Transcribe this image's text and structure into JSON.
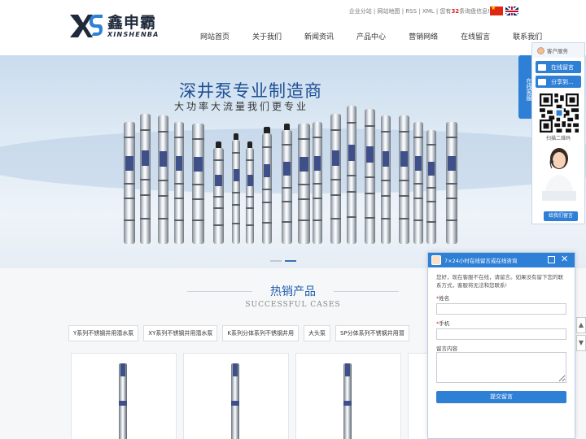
{
  "brand": {
    "name_cn": "鑫申霸",
    "name_en": "XINSHENBA"
  },
  "toplinks": {
    "before": "企业分站 | 网站地图 | RSS | XML | 您有",
    "count": "32",
    "after": "条询盘信息!"
  },
  "nav": {
    "items": [
      {
        "label": "网站首页"
      },
      {
        "label": "关于我们"
      },
      {
        "label": "新闻资讯"
      },
      {
        "label": "产品中心"
      },
      {
        "label": "营销网络"
      },
      {
        "label": "在线留言"
      },
      {
        "label": "联系我们"
      }
    ]
  },
  "banner": {
    "title": "深井泵专业制造商",
    "subtitle": "大功率大流量我们更专业",
    "active_slide": 2
  },
  "hot": {
    "title": "热销产品",
    "subtitle": "SUCCESSFUL CASES",
    "tabs": [
      {
        "label": "Y系列不锈钢井用潜水泵"
      },
      {
        "label": "XY系列不锈钢井用潜水泵"
      },
      {
        "label": "K系列分体系列不锈钢井用"
      },
      {
        "label": "大头泵"
      },
      {
        "label": "SP分体系列不锈钢井用潜"
      }
    ]
  },
  "side": {
    "tab_label": "在线客服",
    "head": "客户服务",
    "btn_message": "在线留言",
    "btn_share": "分享到...",
    "qr_caption": "扫描二维码",
    "leave_msg": "给我们留言"
  },
  "chat": {
    "header": "7×24小时在线留言或在线咨询",
    "welcome": "您好，现在客服不在线，请留言。如果没有留下您的联系方式，客服将无法和您联系!",
    "name_label": "姓名",
    "phone_label": "手机",
    "content_label": "留言内容",
    "submit": "提交留言"
  },
  "colors": {
    "accent": "#2e7fd6",
    "title_blue": "#1e4f96",
    "alert_red": "#dd2222"
  }
}
